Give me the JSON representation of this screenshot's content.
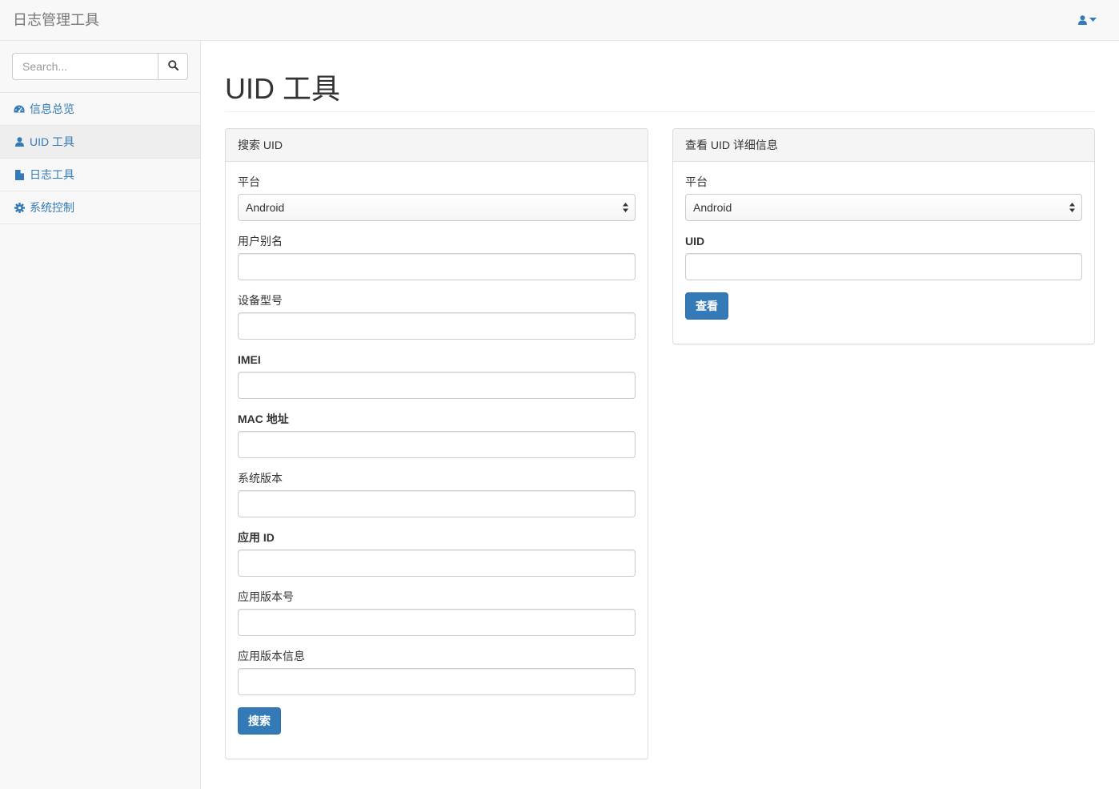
{
  "navbar": {
    "brand": "日志管理工具"
  },
  "sidebar": {
    "search": {
      "placeholder": "Search..."
    },
    "items": [
      {
        "label": "信息总览",
        "icon": "dashboard-icon",
        "active": false
      },
      {
        "label": "UID 工具",
        "icon": "user-icon",
        "active": true
      },
      {
        "label": "日志工具",
        "icon": "file-icon",
        "active": false
      },
      {
        "label": "系统控制",
        "icon": "gear-icon",
        "active": false
      }
    ]
  },
  "page": {
    "title": "UID 工具"
  },
  "search_panel": {
    "heading": "搜索 UID",
    "platform_label": "平台",
    "platform_value": "Android",
    "fields": [
      {
        "label": "用户别名",
        "value": ""
      },
      {
        "label": "设备型号",
        "value": ""
      },
      {
        "label": "IMEI",
        "value": ""
      },
      {
        "label": "MAC 地址",
        "value": ""
      },
      {
        "label": "系统版本",
        "value": ""
      },
      {
        "label": "应用 ID",
        "value": ""
      },
      {
        "label": "应用版本号",
        "value": ""
      },
      {
        "label": "应用版本信息",
        "value": ""
      }
    ],
    "submit_label": "搜索"
  },
  "detail_panel": {
    "heading": "查看 UID 详细信息",
    "platform_label": "平台",
    "platform_value": "Android",
    "uid_label": "UID",
    "uid_value": "",
    "submit_label": "查看"
  },
  "colors": {
    "accent": "#337ab7",
    "navbar_bg": "#f8f8f8",
    "border": "#e7e7e7"
  }
}
